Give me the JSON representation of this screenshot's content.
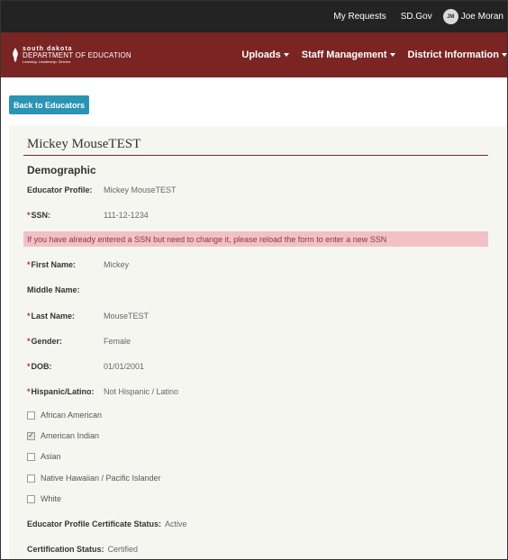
{
  "topbar": {
    "my_requests": "My Requests",
    "sd_gov": "SD.Gov",
    "avatar_initials": "JM",
    "user_name": "Joe Moran"
  },
  "brand": {
    "line1": "south dakota",
    "line2": "DEPARTMENT OF EDUCATION",
    "tagline": "Learning. Leadership. Service."
  },
  "nav": {
    "uploads": "Uploads",
    "staff_management": "Staff Management",
    "district_information": "District Information"
  },
  "back_button": "Back to Educators",
  "card": {
    "title": "Mickey MouseTEST",
    "section": "Demographic"
  },
  "fields": {
    "educator_profile_label": "Educator Profile:",
    "educator_profile_value": "Mickey MouseTEST",
    "ssn_label": "SSN:",
    "ssn_value": "111-12-1234",
    "alert_text": "If you have already entered a SSN but need to change it, please reload the form to enter a new SSN",
    "first_name_label": "First Name:",
    "first_name_value": "Mickey",
    "middle_name_label": "Middle Name:",
    "middle_name_value": "",
    "last_name_label": "Last Name:",
    "last_name_value": "MouseTEST",
    "gender_label": "Gender:",
    "gender_value": "Female",
    "dob_label": "DOB:",
    "dob_value": "01/01/2001",
    "hispanic_label": "Hispanic/Latino:",
    "hispanic_value": "Not Hispanic / Latino",
    "required_marker": "*"
  },
  "race": [
    {
      "label": "African American",
      "checked": false
    },
    {
      "label": "American Indian",
      "checked": true
    },
    {
      "label": "Asian",
      "checked": false
    },
    {
      "label": "Native Hawaiian / Pacific Islander",
      "checked": false
    },
    {
      "label": "White",
      "checked": false
    }
  ],
  "status": {
    "certificate_status_label": "Educator Profile Certificate Status:",
    "certificate_status_value": "Active",
    "certification_status_label": "Certification Status:",
    "certification_status_value": "Certified"
  },
  "colors": {
    "topbar": "#232323",
    "brand": "#7a2523",
    "button": "#2a94b4",
    "alert_bg": "#f2c1c6",
    "card_bg": "#f6f6f1"
  }
}
